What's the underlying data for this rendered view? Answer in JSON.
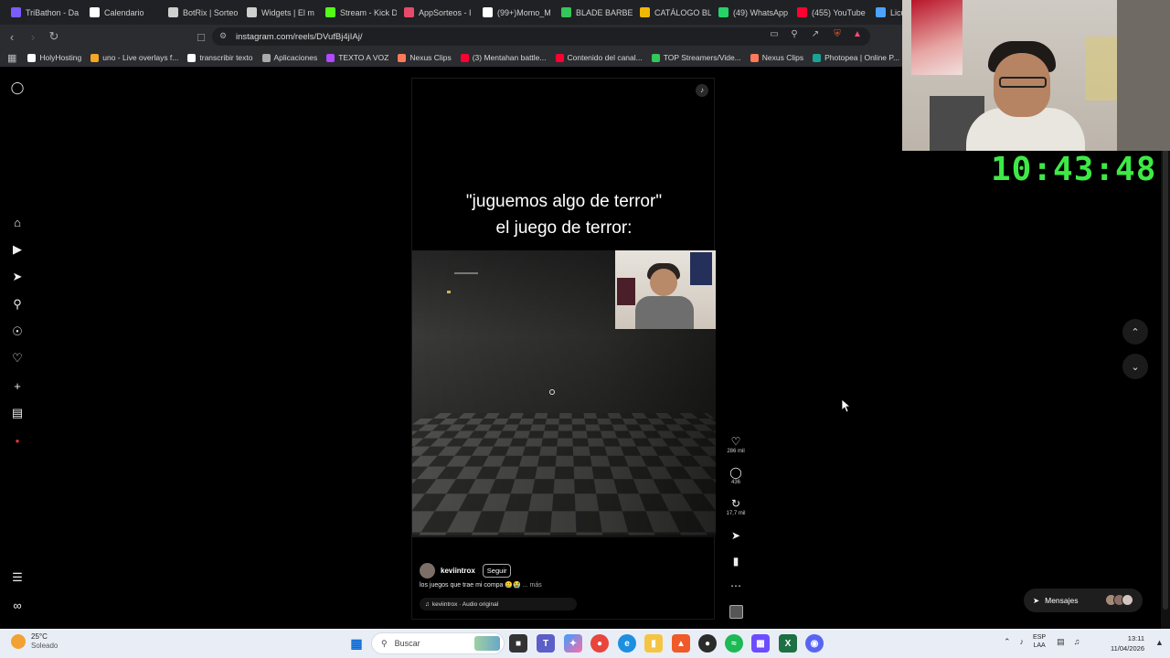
{
  "tabs": [
    {
      "label": "TriBathon - Da",
      "color": "#7b5cff"
    },
    {
      "label": "Calendario",
      "color": "#ffffff"
    },
    {
      "label": "BotRix | Sorteo",
      "color": "#cfcfcf"
    },
    {
      "label": "Widgets | El m",
      "color": "#cfcfcf"
    },
    {
      "label": "Stream - Kick D",
      "color": "#53fc18"
    },
    {
      "label": "AppSorteos - I",
      "color": "#e84a6a"
    },
    {
      "label": "(99+)Momo_M",
      "color": "#ffffff"
    },
    {
      "label": "BLADE BARBER",
      "color": "#34c759"
    },
    {
      "label": "CATÁLOGO BL",
      "color": "#f2b705"
    },
    {
      "label": "(49) WhatsApp",
      "color": "#25d366"
    },
    {
      "label": "(455) YouTube",
      "color": "#ff0033"
    },
    {
      "label": "Licu",
      "color": "#4aa3ff"
    }
  ],
  "address": {
    "url": "instagram.com/reels/DVufBj4jIAj/"
  },
  "bookmarks": [
    {
      "label": "HolyHosting",
      "color": "#ffffff"
    },
    {
      "label": "uno - Live overlays f...",
      "color": "#f5a623"
    },
    {
      "label": "transcribir texto",
      "color": "#ffffff"
    },
    {
      "label": "Aplicaciones",
      "color": "#aaaaaa"
    },
    {
      "label": "TEXTO A VOZ",
      "color": "#b04aff"
    },
    {
      "label": "Nexus Clips",
      "color": "#ff7a59"
    },
    {
      "label": "(3) Mentahan battle...",
      "color": "#ff0033"
    },
    {
      "label": "Contenido del canal...",
      "color": "#ff0033"
    },
    {
      "label": "TOP Streamers/Vide...",
      "color": "#34c759"
    },
    {
      "label": "Nexus Clips",
      "color": "#ff7a59"
    },
    {
      "label": "Photopea | Online P...",
      "color": "#18a497"
    }
  ],
  "sidebar": {
    "icons": [
      "instagram-icon",
      "home-icon",
      "reels-icon",
      "send-icon",
      "search-icon",
      "explore-icon",
      "heart-icon",
      "create-icon",
      "dashboard-icon",
      "profile-icon",
      "menu-icon",
      "meta-icon"
    ]
  },
  "reel": {
    "caption_line1": "\"juguemos algo de terror\"",
    "caption_line2": "el juego de terror:",
    "author": "keviintrox",
    "follow_label": "Seguir",
    "description": "los juegos que trae mi compa 🥲😭",
    "more_label": "... más",
    "audio": "keviintrox · Audio original"
  },
  "actions": {
    "likes": "286 mil",
    "comments": "436",
    "reposts": "17,7 mil"
  },
  "messages": {
    "label": "Mensajes"
  },
  "overlay": {
    "clock": "10:43:48"
  },
  "taskbar": {
    "temperature": "25°C",
    "weather": "Soleado",
    "search_placeholder": "Buscar",
    "lang_line1": "ESP",
    "lang_line2": "LAA",
    "time": "13:11",
    "date": "11/04/2026"
  }
}
